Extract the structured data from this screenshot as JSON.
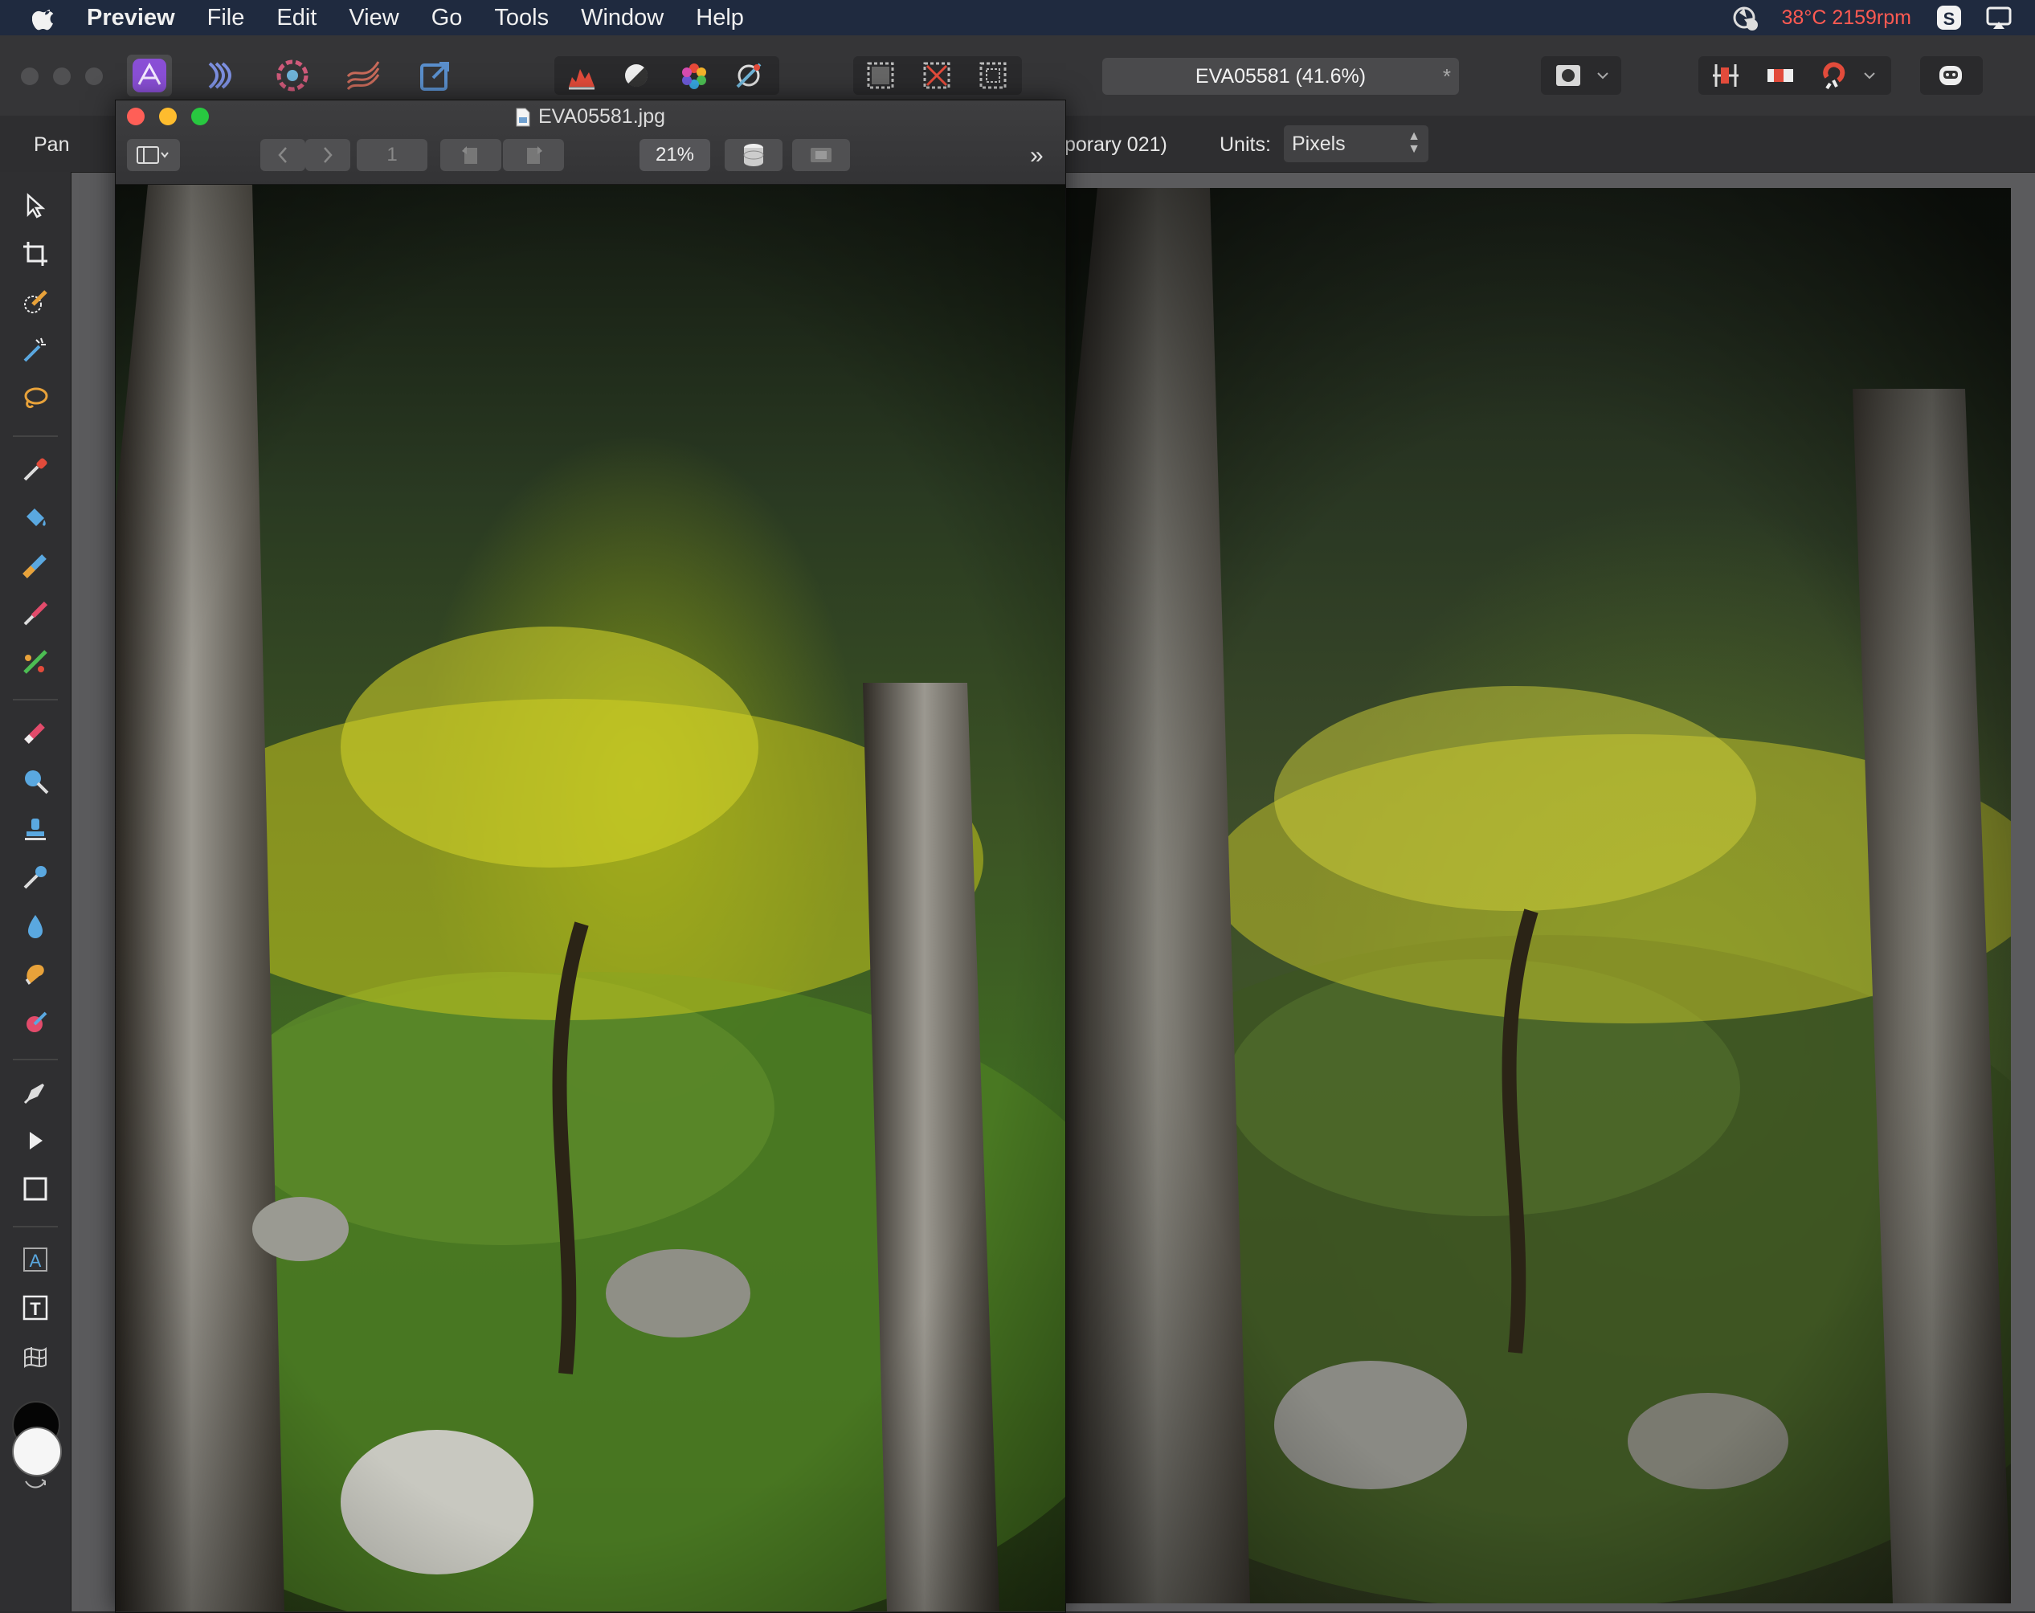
{
  "menubar": {
    "app_name": "Preview",
    "items": [
      "File",
      "Edit",
      "View",
      "Go",
      "Tools",
      "Window",
      "Help"
    ],
    "status_text": "38°C 2159rpm",
    "status_color": "#ff5a52"
  },
  "toolbar": {
    "document_title": "EVA05581 (41.6%)",
    "document_modified_mark": "*",
    "personas": [
      "photo-persona-icon",
      "liquify-persona-icon",
      "develop-persona-icon",
      "tone-mapping-persona-icon",
      "export-persona-icon"
    ],
    "adjust_buttons": [
      "histogram-auto-levels-icon",
      "auto-contrast-icon",
      "auto-colour-icon",
      "auto-white-balance-icon"
    ],
    "selection_buttons": [
      "select-all-icon",
      "deselect-icon",
      "invert-selection-icon"
    ]
  },
  "context_bar": {
    "tool_name": "Pan",
    "document_partial": "porary 021)",
    "units_label": "Units:",
    "units_value": "Pixels"
  },
  "tools": [
    "move-tool-icon",
    "crop-tool-icon",
    "selection-brush-icon",
    "flood-select-icon",
    "freehand-select-icon",
    "colour-picker-icon",
    "flood-fill-icon",
    "gradient-tool-icon",
    "paint-brush-icon",
    "pixel-tool-icon",
    "erase-brush-icon",
    "dodge-brush-icon",
    "clone-brush-icon",
    "smudge-brush-icon",
    "blur-brush-icon",
    "burn-brush-icon",
    "inpainting-brush-icon",
    "pen-tool-icon",
    "node-tool-icon",
    "rectangle-tool-icon",
    "artistic-text-tool-icon",
    "frame-text-tool-icon",
    "mesh-warp-tool-icon"
  ],
  "preview_window": {
    "filename": "EVA05581.jpg",
    "page_number": "1",
    "zoom": "21%",
    "more": "»"
  }
}
